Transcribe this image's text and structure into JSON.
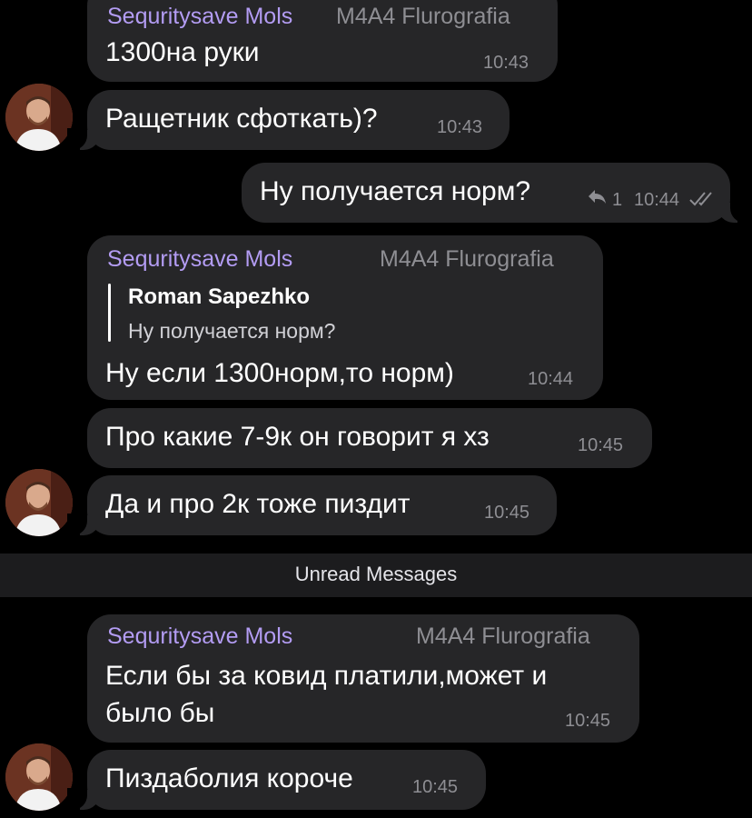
{
  "messages": [
    {
      "sender": "Sequritysave Mols",
      "channel": "M4A4 Flurografia",
      "text": "1300на руки",
      "time": "10:43"
    },
    {
      "text": "Ращетник сфоткать)?",
      "time": "10:43"
    },
    {
      "text": "Ну получается норм?",
      "replies": "1",
      "time": "10:44"
    },
    {
      "sender": "Sequritysave Mols",
      "channel": "M4A4 Flurografia",
      "quote_author": "Roman Sapezhko",
      "quote_text": "Ну получается норм?",
      "text": "Ну если 1300норм,то норм)",
      "time": "10:44"
    },
    {
      "text": "Про какие 7-9к он говорит я хз",
      "time": "10:45"
    },
    {
      "text": "Да и про 2к тоже пиздит",
      "time": "10:45"
    },
    {
      "sender": "Sequritysave Mols",
      "channel": "M4A4 Flurografia",
      "text_line1": "Если бы за ковид платили,может  и",
      "text_line2": "было бы",
      "time": "10:45"
    },
    {
      "text": "Пиздаболия короче",
      "time": "10:45"
    }
  ],
  "unread_divider": "Unread Messages",
  "colors": {
    "background": "#000000",
    "bubble": "#262628",
    "sender": "#b39cf3",
    "meta": "#8e8e93"
  }
}
